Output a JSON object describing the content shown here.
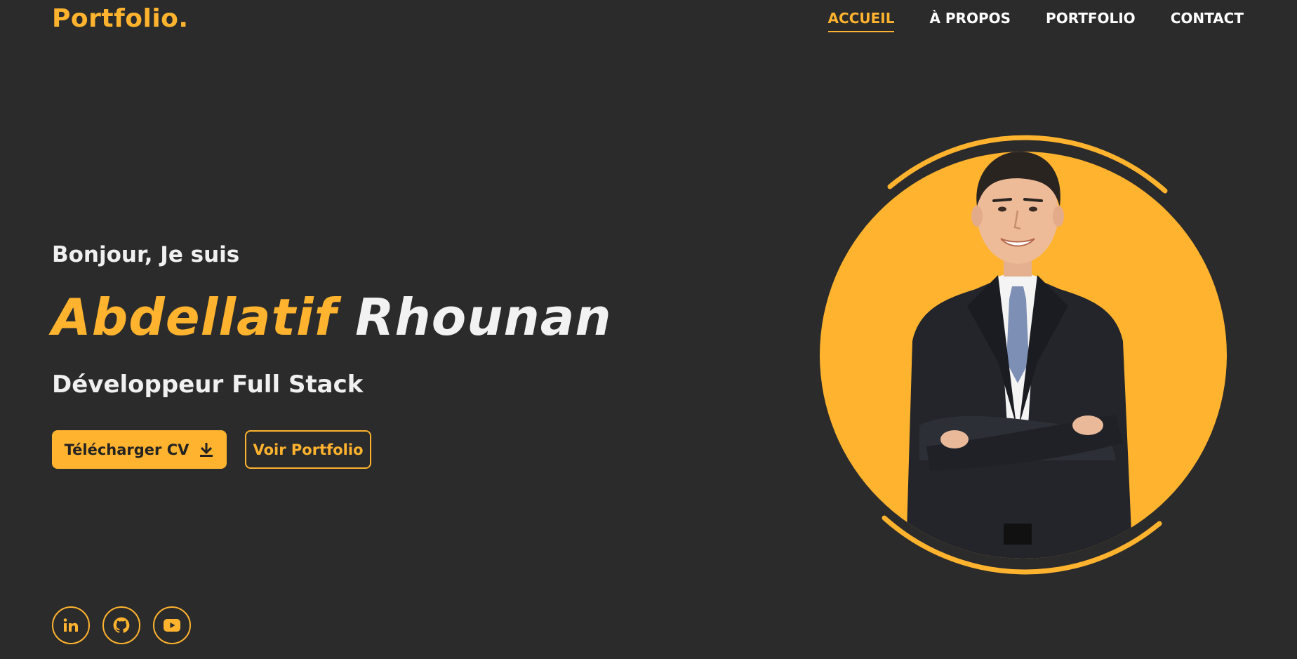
{
  "header": {
    "logo": "Portfolio.",
    "nav": [
      {
        "label": "ACCUEIL",
        "active": true
      },
      {
        "label": "À PROPOS",
        "active": false
      },
      {
        "label": "PORTFOLIO",
        "active": false
      },
      {
        "label": "CONTACT",
        "active": false
      }
    ]
  },
  "hero": {
    "greeting": "Bonjour, Je suis",
    "first_name": "Abdellatif",
    "last_name": "Rhounan",
    "role": "Développeur Full Stack",
    "download_cv_label": "Télécharger CV",
    "download_icon": "download-icon",
    "portfolio_label": "Voir Portfolio"
  },
  "socials": [
    {
      "name": "linkedin-icon"
    },
    {
      "name": "github-icon"
    },
    {
      "name": "youtube-icon"
    }
  ],
  "colors": {
    "background": "#2b2b2b",
    "accent": "#ffb32e",
    "text": "#ffffff"
  }
}
